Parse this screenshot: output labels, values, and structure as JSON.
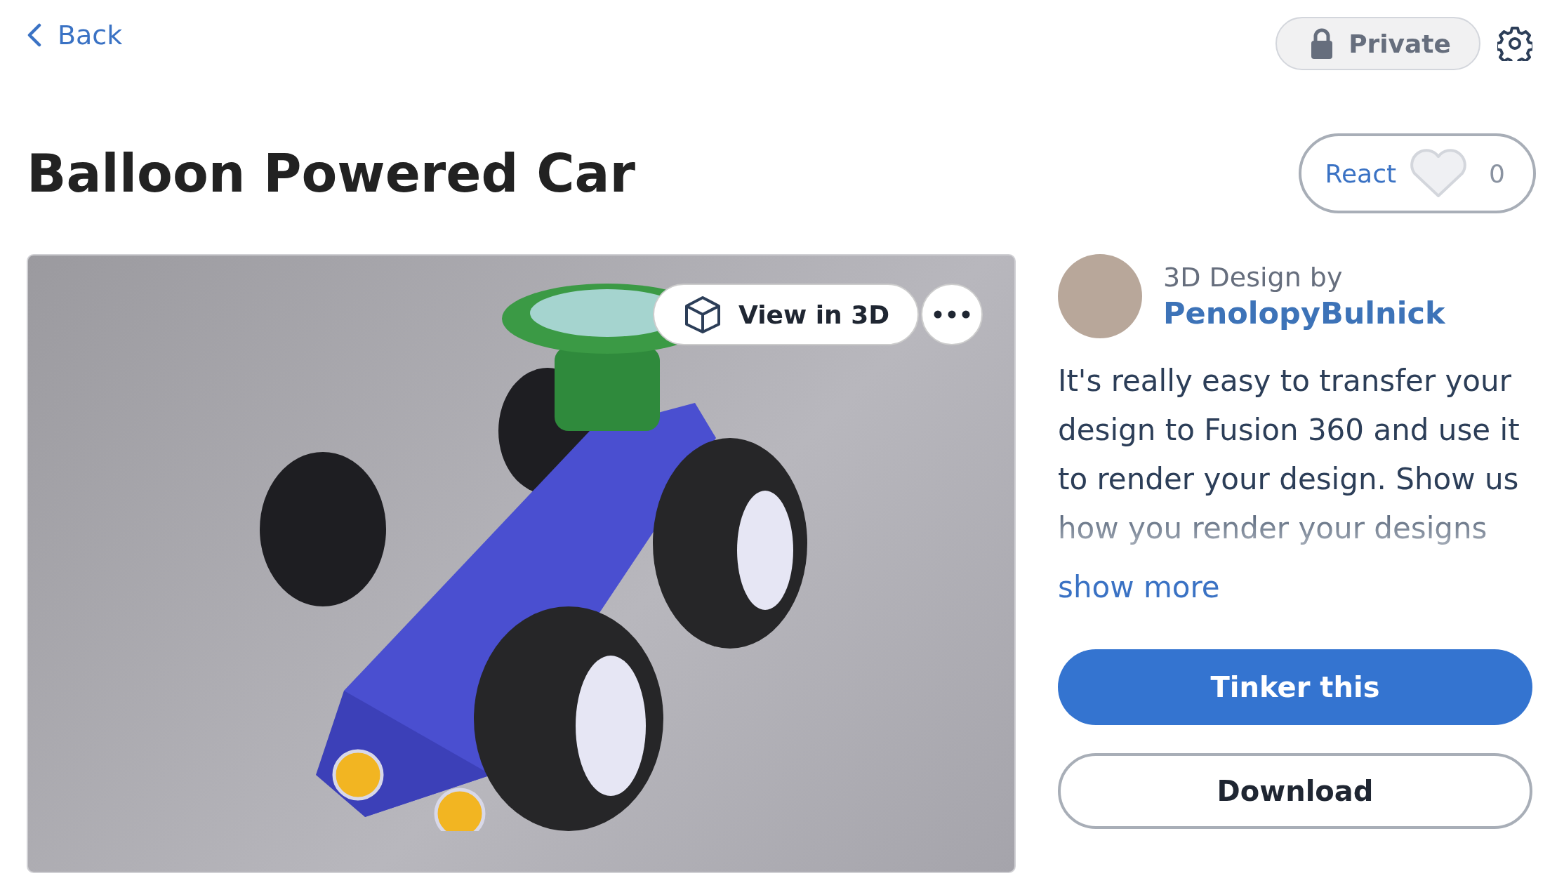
{
  "back": {
    "label": "Back"
  },
  "privacy": {
    "label": "Private"
  },
  "title": "Balloon Powered Car",
  "react": {
    "label": "React",
    "count": "0",
    "reacted": false
  },
  "viewer": {
    "view_button": "View in 3D"
  },
  "author": {
    "caption": "3D Design by",
    "name": "PenolopyBulnick"
  },
  "description": "It's really easy to transfer your design to Fusion 360 and use it to render your design. Show us how you render your designs",
  "show_more": "show more",
  "actions": [
    {
      "label": "Tinker this",
      "kind": "primary"
    },
    {
      "label": "Download",
      "kind": "secondary"
    }
  ]
}
